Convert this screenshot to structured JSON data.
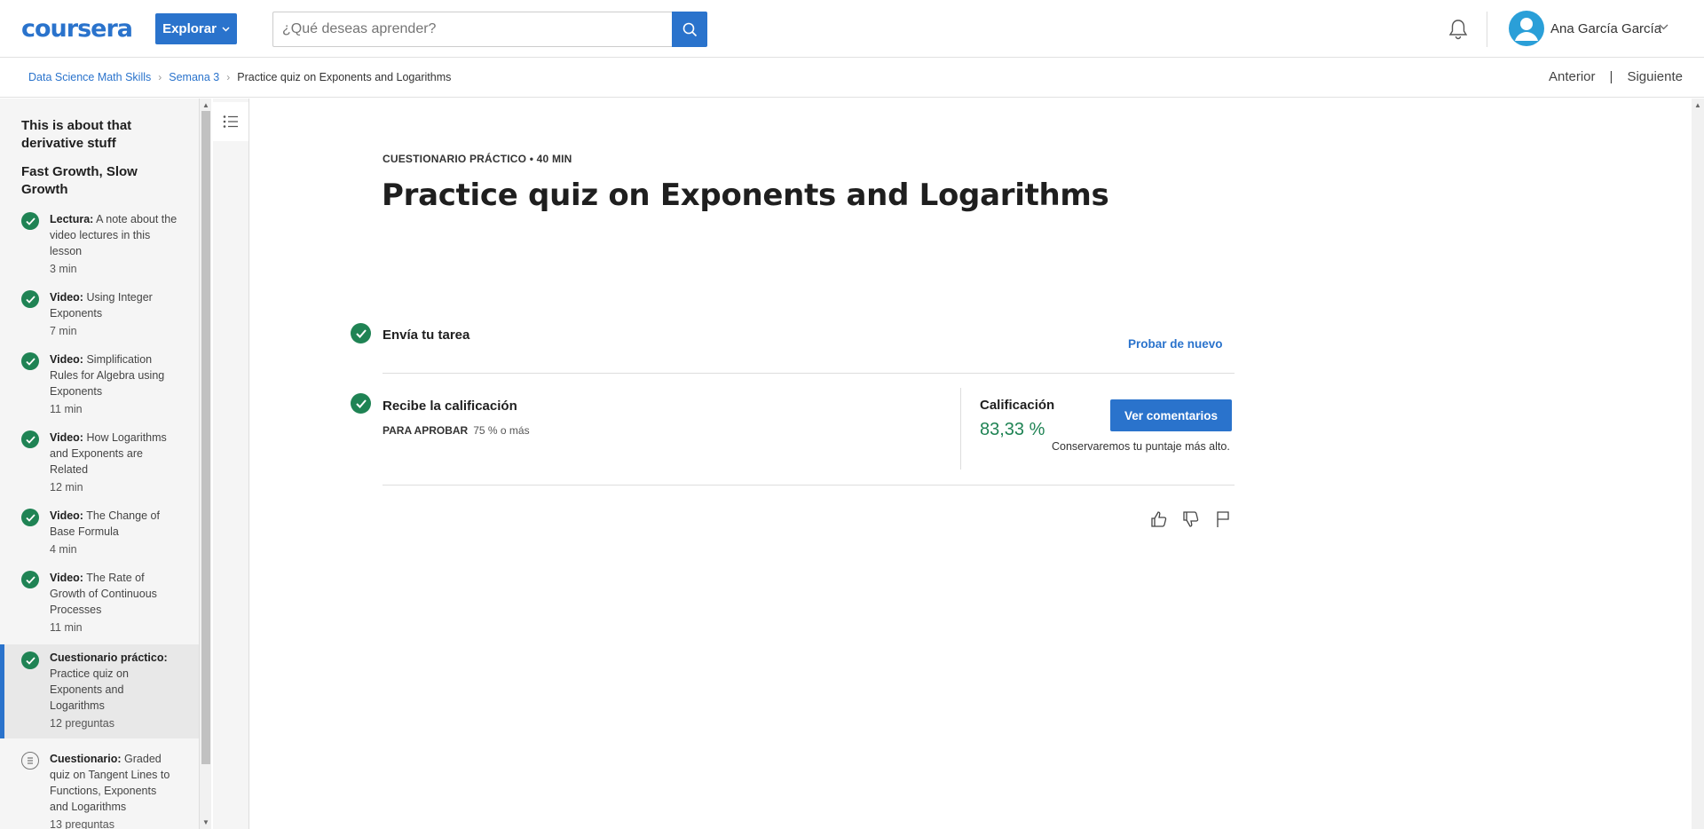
{
  "header": {
    "logo": "coursera",
    "explore_label": "Explorar",
    "search_placeholder": "¿Qué deseas aprender?",
    "user_name": "Ana García García"
  },
  "breadcrumb": {
    "items": [
      "Data Science Math Skills",
      "Semana 3"
    ],
    "current": "Practice quiz on Exponents and Logarithms"
  },
  "nav": {
    "previous": "Anterior",
    "separator": "|",
    "next": "Siguiente"
  },
  "sidebar": {
    "headings": [
      "This is about that derivative stuff",
      "Fast Growth, Slow Growth"
    ],
    "items": [
      {
        "kind": "Lectura:",
        "title": "A note about the video lectures in this lesson",
        "duration": "3 min",
        "status": "done"
      },
      {
        "kind": "Video:",
        "title": "Using Integer Exponents",
        "duration": "7 min",
        "status": "done"
      },
      {
        "kind": "Video:",
        "title": "Simplification Rules for Algebra using Exponents",
        "duration": "11 min",
        "status": "done"
      },
      {
        "kind": "Video:",
        "title": "How Logarithms and Exponents are Related",
        "duration": "12 min",
        "status": "done"
      },
      {
        "kind": "Video:",
        "title": "The Change of Base Formula",
        "duration": "4 min",
        "status": "done"
      },
      {
        "kind": "Video:",
        "title": "The Rate of Growth of Continuous Processes",
        "duration": "11 min",
        "status": "done"
      },
      {
        "kind": "Cuestionario práctico:",
        "title": "Practice quiz on Exponents and Logarithms",
        "duration": "12 preguntas",
        "status": "done-active"
      },
      {
        "kind": "Cuestionario:",
        "title": "Graded quiz on Tangent Lines to Functions, Exponents and Logarithms",
        "duration": "13 preguntas",
        "status": "quiz"
      }
    ]
  },
  "main": {
    "meta": "CUESTIONARIO PRÁCTICO • 40 MIN",
    "title": "Practice quiz on Exponents and Logarithms",
    "step1_label": "Envía tu tarea",
    "retry_label": "Probar de nuevo",
    "step2_label": "Recibe la calificación",
    "pass_label": "PARA APROBAR",
    "pass_value": "75 % o más",
    "grade_label": "Calificación",
    "grade_value": "83,33 %",
    "feedback_button": "Ver comentarios",
    "keep_note": "Conservaremos tu puntaje más alto."
  },
  "colors": {
    "brand": "#2a73cc",
    "success": "#1f8354"
  },
  "icons": [
    "chevron-down-icon",
    "search-icon",
    "bell-icon",
    "user-icon",
    "outline-list-icon",
    "check-icon",
    "quiz-icon",
    "thumbs-up-icon",
    "thumbs-down-icon",
    "flag-icon"
  ]
}
